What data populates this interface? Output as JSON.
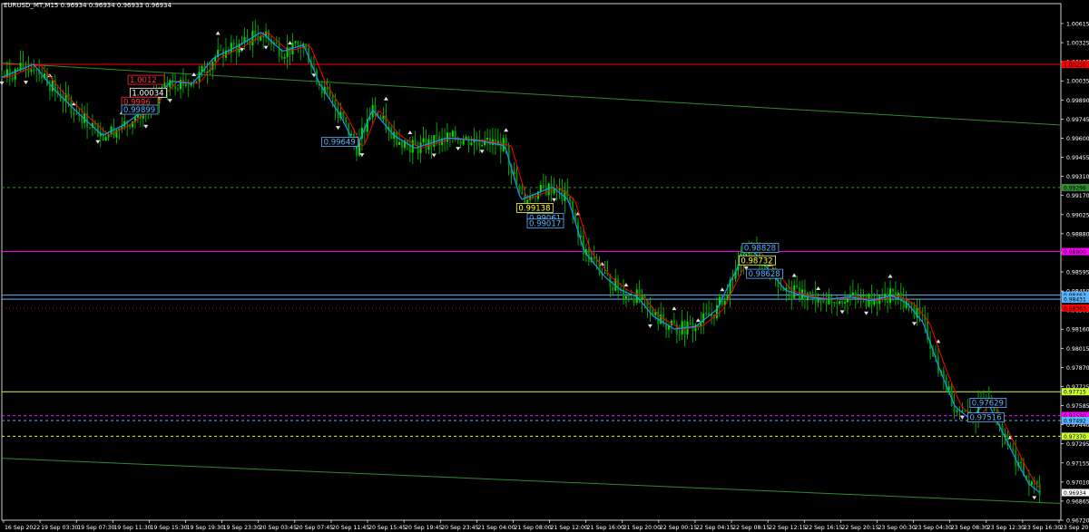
{
  "chart_title": "EURUSD_MT,M15  0.96934 0.96934 0.96933 0.96934",
  "chart_data": {
    "type": "candlestick",
    "symbol": "EURUSD_MT",
    "timeframe": "M15",
    "ohlc_header": {
      "open": "0.96934",
      "high": "0.96934",
      "low": "0.96933",
      "close": "0.96934"
    },
    "ylim": [
      0.9672,
      1.0072
    ],
    "y_ticks": [
      "1.00615",
      "1.00325",
      "1.00180",
      "1.00035",
      "0.99890",
      "0.99745",
      "0.99600",
      "0.99455",
      "0.99310",
      "0.99170",
      "0.99025",
      "0.98880",
      "0.98735",
      "0.98595",
      "0.98450",
      "0.98305",
      "0.98160",
      "0.98015",
      "0.97870",
      "0.97725",
      "0.97585",
      "0.97440",
      "0.97295",
      "0.97155",
      "0.97010",
      "0.96865",
      "0.96720"
    ],
    "x_ticks": [
      "16 Sep 2022",
      "19 Sep 03:30",
      "19 Sep 07:30",
      "19 Sep 11:30",
      "19 Sep 15:30",
      "19 Sep 19:30",
      "19 Sep 23:30",
      "20 Sep 03:45",
      "20 Sep 07:45",
      "20 Sep 11:45",
      "20 Sep 15:45",
      "20 Sep 19:45",
      "20 Sep 23:45",
      "21 Sep 04:00",
      "21 Sep 08:00",
      "21 Sep 12:00",
      "21 Sep 16:00",
      "21 Sep 20:00",
      "22 Sep 00:15",
      "22 Sep 04:15",
      "22 Sep 08:15",
      "22 Sep 12:15",
      "22 Sep 16:15",
      "22 Sep 20:15",
      "23 Sep 00:30",
      "23 Sep 04:30",
      "23 Sep 08:30",
      "23 Sep 12:30",
      "23 Sep 16:30",
      "23 Sep 20:30"
    ],
    "price_path": [
      [
        0,
        1.0015
      ],
      [
        0.03,
        1.0025
      ],
      [
        0.05,
        1.0005
      ],
      [
        0.075,
        0.9985
      ],
      [
        0.095,
        0.997
      ],
      [
        0.115,
        0.9978
      ],
      [
        0.135,
        0.999
      ],
      [
        0.16,
        1.0012
      ],
      [
        0.18,
        1.001
      ],
      [
        0.2,
        1.003
      ],
      [
        0.225,
        1.004
      ],
      [
        0.245,
        1.005
      ],
      [
        0.265,
        1.0035
      ],
      [
        0.285,
        1.004
      ],
      [
        0.3,
        1.001
      ],
      [
        0.32,
        0.9985
      ],
      [
        0.335,
        0.996
      ],
      [
        0.35,
        0.999
      ],
      [
        0.37,
        0.997
      ],
      [
        0.39,
        0.996
      ],
      [
        0.42,
        0.9968
      ],
      [
        0.45,
        0.9966
      ],
      [
        0.475,
        0.9962
      ],
      [
        0.49,
        0.992
      ],
      [
        0.505,
        0.9925
      ],
      [
        0.52,
        0.993
      ],
      [
        0.535,
        0.992
      ],
      [
        0.55,
        0.988
      ],
      [
        0.57,
        0.986
      ],
      [
        0.585,
        0.985
      ],
      [
        0.6,
        0.9845
      ],
      [
        0.615,
        0.983
      ],
      [
        0.635,
        0.982
      ],
      [
        0.655,
        0.9822
      ],
      [
        0.675,
        0.9835
      ],
      [
        0.69,
        0.986
      ],
      [
        0.705,
        0.9885
      ],
      [
        0.72,
        0.987
      ],
      [
        0.74,
        0.985
      ],
      [
        0.76,
        0.9845
      ],
      [
        0.78,
        0.9843
      ],
      [
        0.8,
        0.9845
      ],
      [
        0.82,
        0.9842
      ],
      [
        0.84,
        0.9846
      ],
      [
        0.855,
        0.984
      ],
      [
        0.87,
        0.9825
      ],
      [
        0.885,
        0.979
      ],
      [
        0.9,
        0.976
      ],
      [
        0.915,
        0.975
      ],
      [
        0.93,
        0.9765
      ],
      [
        0.945,
        0.974
      ],
      [
        0.96,
        0.9715
      ],
      [
        0.97,
        0.97
      ],
      [
        0.98,
        0.96934
      ]
    ],
    "horizontal_lines": [
      {
        "price": 1.0025,
        "label": "1.00250",
        "color": "#ff0000",
        "style": "solid"
      },
      {
        "price": 0.988,
        "label": "0.98800",
        "color": "#ff00ff",
        "style": "solid"
      },
      {
        "price": 0.98463,
        "label": "0.98463",
        "color": "#5ab4ff",
        "style": "solid"
      },
      {
        "price": 0.98431,
        "label": "0.98431",
        "color": "#5ab4ff",
        "style": "solid"
      },
      {
        "price": 0.98363,
        "label": "0.98363",
        "color": "#ff0000",
        "style": "dotted"
      },
      {
        "price": 0.99296,
        "label": "0.99296",
        "color": "#2e8b2e",
        "style": "dashed"
      },
      {
        "price": 0.97715,
        "label": "0.97715",
        "color": "#ccff33",
        "style": "solid"
      },
      {
        "price": 0.9753,
        "label": "0.97530",
        "color": "#ff00ff",
        "style": "dashed"
      },
      {
        "price": 0.97492,
        "label": "0.97492",
        "color": "#5ab4ff",
        "style": "dashed"
      },
      {
        "price": 0.9737,
        "label": "0.97370",
        "color": "#ccff33",
        "style": "dashed"
      }
    ],
    "trend_lines": [
      {
        "from": [
          0.0,
          1.0026
        ],
        "to": [
          1.0,
          0.9978
        ],
        "color": "#2e8b2e"
      },
      {
        "from": [
          0.0,
          0.972
        ],
        "to": [
          1.0,
          0.9685
        ],
        "color": "#2e8b2e"
      }
    ],
    "marker_labels": [
      {
        "text": "1.0012",
        "x": 0.12,
        "price": 1.0013,
        "color": "#ff3030"
      },
      {
        "text": "1.00034",
        "x": 0.122,
        "price": 1.0003,
        "color": "#ffffff"
      },
      {
        "text": "0.9996",
        "x": 0.114,
        "price": 0.9996,
        "color": "#ff3030"
      },
      {
        "text": "0.99899",
        "x": 0.114,
        "price": 0.99899,
        "color": "#5ab4ff"
      },
      {
        "text": "0.99649",
        "x": 0.303,
        "price": 0.99649,
        "color": "#5ab4ff"
      },
      {
        "text": "0.99138",
        "x": 0.487,
        "price": 0.99138,
        "color": "#ffff33"
      },
      {
        "text": "0.99061",
        "x": 0.497,
        "price": 0.99061,
        "color": "#5ab4ff"
      },
      {
        "text": "0.99017",
        "x": 0.497,
        "price": 0.99017,
        "color": "#5ab4ff"
      },
      {
        "text": "0.98828",
        "x": 0.7,
        "price": 0.98828,
        "color": "#5ab4ff"
      },
      {
        "text": "0.98732",
        "x": 0.697,
        "price": 0.98732,
        "color": "#ffff33"
      },
      {
        "text": "0.98628",
        "x": 0.704,
        "price": 0.98628,
        "color": "#5ab4ff"
      },
      {
        "text": "0.97629",
        "x": 0.915,
        "price": 0.97629,
        "color": "#5ab4ff"
      },
      {
        "text": "0.97516",
        "x": 0.913,
        "price": 0.97516,
        "color": "#5ab4ff"
      }
    ],
    "current_price": {
      "price": 0.96934,
      "label": "0.96934"
    },
    "colors": {
      "background": "#000000",
      "axis": "#ffffff",
      "bull": "#00c800",
      "bear": "#00c800",
      "ma_fast": "#1e90ff",
      "ma_slow": "#ff0000",
      "grid": "none"
    }
  }
}
